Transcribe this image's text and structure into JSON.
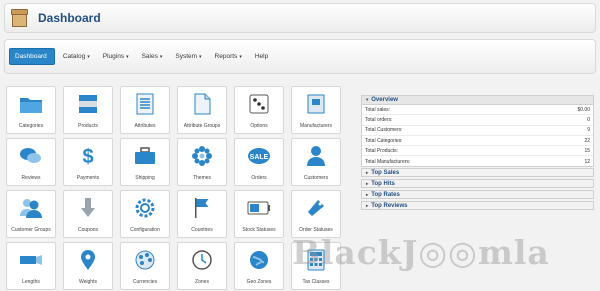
{
  "header": {
    "title": "Dashboard"
  },
  "nav": {
    "items": [
      {
        "label": "Dashboard",
        "caret": ""
      },
      {
        "label": "Catalog",
        "caret": "▾"
      },
      {
        "label": "Plugins",
        "caret": "▾"
      },
      {
        "label": "Sales",
        "caret": "▾"
      },
      {
        "label": "System",
        "caret": "▾"
      },
      {
        "label": "Reports",
        "caret": "▾"
      },
      {
        "label": "Help",
        "caret": ""
      }
    ]
  },
  "tiles": [
    {
      "label": "Categories",
      "icon": "folder-icon"
    },
    {
      "label": "Products",
      "icon": "products-icon"
    },
    {
      "label": "Attributes",
      "icon": "document-list-icon"
    },
    {
      "label": "Attribute Groups",
      "icon": "document-icon"
    },
    {
      "label": "Options",
      "icon": "dice-icon"
    },
    {
      "label": "Manufacturers",
      "icon": "manufacturer-box-icon"
    },
    {
      "label": "Reviews",
      "icon": "speech-bubbles-icon"
    },
    {
      "label": "Payments",
      "icon": "dollar-icon"
    },
    {
      "label": "Shipping",
      "icon": "briefcase-icon"
    },
    {
      "label": "Themes",
      "icon": "flower-icon"
    },
    {
      "label": "Orders",
      "icon": "sale-badge-icon"
    },
    {
      "label": "Customers",
      "icon": "person-icon"
    },
    {
      "label": "Customer Groups",
      "icon": "user-group-icon"
    },
    {
      "label": "Coupons",
      "icon": "arrow-down-icon"
    },
    {
      "label": "Configuration",
      "icon": "gear-icon"
    },
    {
      "label": "Countries",
      "icon": "flag-icon"
    },
    {
      "label": "Stock Statuses",
      "icon": "battery-icon"
    },
    {
      "label": "Order Statuses",
      "icon": "tag-icon"
    },
    {
      "label": "Lengths",
      "icon": "ruler-icon"
    },
    {
      "label": "Weights",
      "icon": "map-pin-icon"
    },
    {
      "label": "Currencies",
      "icon": "palette-icon"
    },
    {
      "label": "Zones",
      "icon": "clock-icon"
    },
    {
      "label": "Geo Zones",
      "icon": "globe-icon"
    },
    {
      "label": "Tax Classes",
      "icon": "calculator-icon"
    }
  ],
  "overview": {
    "title": "Overview",
    "arrow": "▾",
    "stats": [
      {
        "label": "Total sales:",
        "value": "$0.00"
      },
      {
        "label": "Total orders:",
        "value": "0"
      },
      {
        "label": "Total Customers:",
        "value": "9"
      },
      {
        "label": "Total Categories:",
        "value": "22"
      },
      {
        "label": "Total Products:",
        "value": "15"
      },
      {
        "label": "Total Manufacturers:",
        "value": "12"
      }
    ]
  },
  "panels": [
    {
      "title": "Top Sales",
      "arrow": "▸"
    },
    {
      "title": "Top Hits",
      "arrow": "▸"
    },
    {
      "title": "Top Rates",
      "arrow": "▸"
    },
    {
      "title": "Top Reviews",
      "arrow": "▸"
    }
  ],
  "watermark": "BlackJ◎◎mla",
  "colors": {
    "accent": "#2a86c8",
    "title": "#1f4f82"
  }
}
